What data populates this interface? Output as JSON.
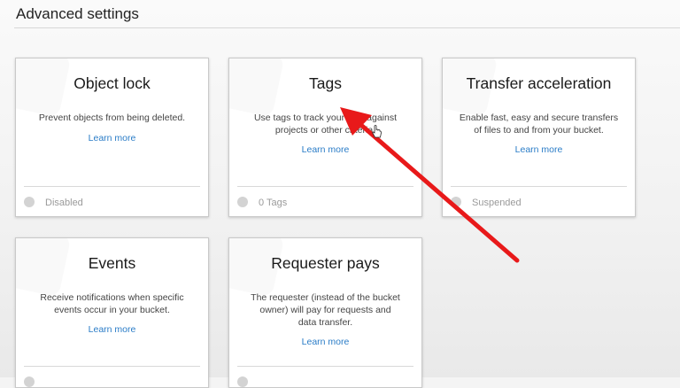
{
  "section": {
    "title": "Advanced settings"
  },
  "cards": [
    {
      "title": "Object lock",
      "description": "Prevent objects from being deleted.",
      "link": "Learn more",
      "status": "Disabled"
    },
    {
      "title": "Tags",
      "description": "Use tags to track your cost against projects or other criteria.",
      "link": "Learn more",
      "status": "0 Tags"
    },
    {
      "title": "Transfer acceleration",
      "description": "Enable fast, easy and secure transfers of files to and from your bucket.",
      "link": "Learn more",
      "status": "Suspended"
    },
    {
      "title": "Events",
      "description": "Receive notifications when specific events occur in your bucket.",
      "link": "Learn more",
      "status": ""
    },
    {
      "title": "Requester pays",
      "description": "The requester (instead of the bucket owner) will pay for requests and data transfer.",
      "link": "Learn more",
      "status": ""
    }
  ],
  "colors": {
    "link": "#2a7cc7",
    "annotation_arrow": "#e8191a",
    "status_dot": "#d3d3d3"
  },
  "icons": {
    "cursor": "hand-pointer-icon",
    "annotation": "red-arrow-icon"
  }
}
